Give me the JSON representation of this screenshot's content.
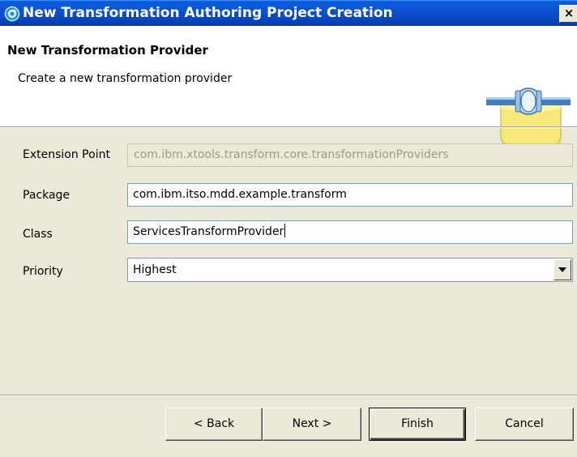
{
  "window": {
    "title": "New Transformation Authoring Project Creation",
    "close_label": "×"
  },
  "banner": {
    "title": "New Transformation Provider",
    "subtitle": "Create a new transformation provider"
  },
  "form": {
    "extension_point": {
      "label": "Extension Point",
      "value": "com.ibm.xtools.transform.core.transformationProviders",
      "enabled": false
    },
    "package": {
      "label": "Package",
      "value": "com.ibm.itso.mdd.example.transform"
    },
    "class": {
      "label": "Class",
      "value": "ServicesTransformProvider"
    },
    "priority": {
      "label": "Priority",
      "selected": "Highest"
    }
  },
  "buttons": {
    "back": "< Back",
    "next": "Next >",
    "finish": "Finish",
    "cancel": "Cancel"
  },
  "colors": {
    "titlebar": "#0b55d4",
    "dialog_bg": "#ece9d8",
    "banner_bg": "#ffffff",
    "field_border": "#7f9db9",
    "disabled_text": "#9d9a8d"
  },
  "icons": {
    "app": "eclipse-icon",
    "banner": "transformation-plug-icon",
    "dropdown": "dropdown-arrow-icon",
    "close": "close-icon"
  }
}
